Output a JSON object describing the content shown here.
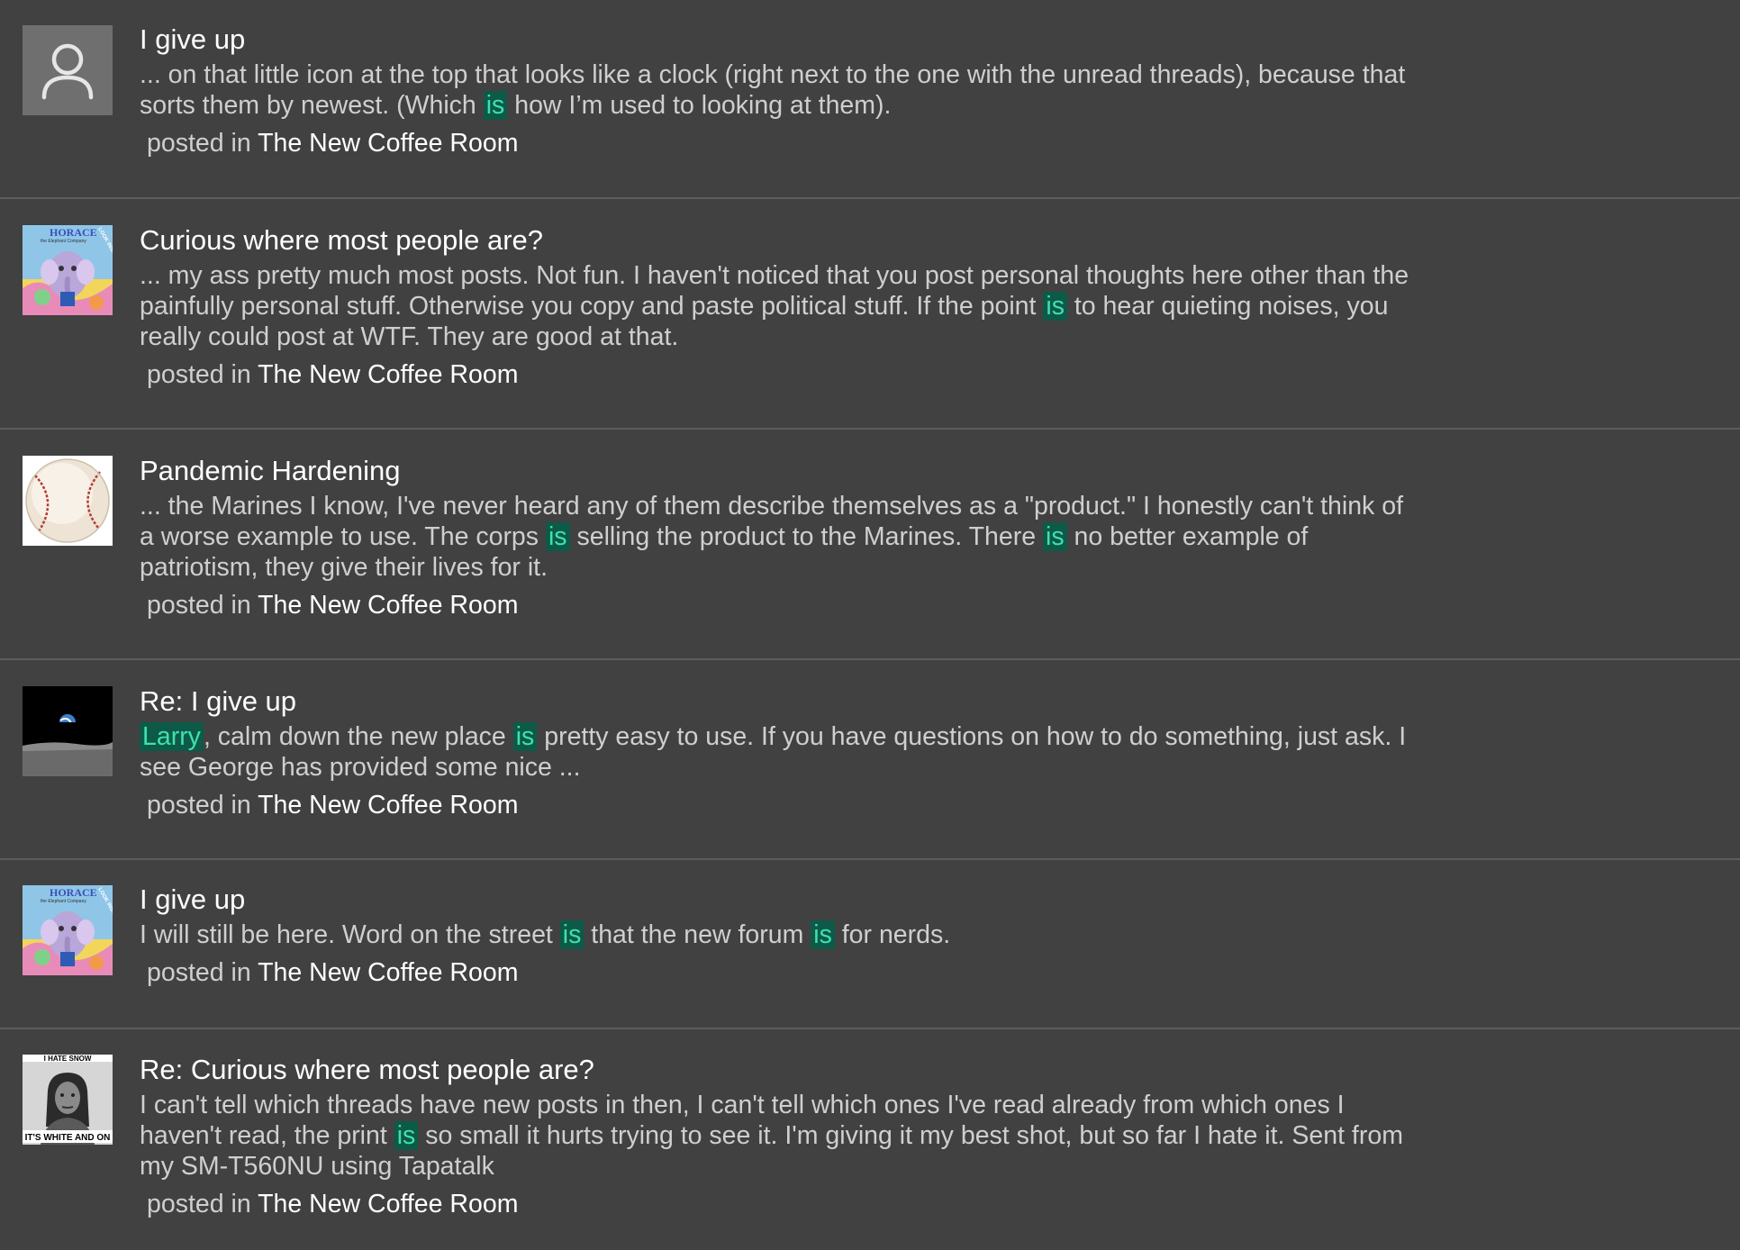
{
  "colors": {
    "background": "#414141",
    "divider": "#5c5c5c",
    "title_text": "#ffffff",
    "body_text": "#cfcfcf",
    "highlight_bg": "#0c5a47",
    "highlight_text": "#3fe0b0"
  },
  "results": [
    {
      "title": "I give up",
      "avatar": "default-user-icon",
      "snippet_parts": [
        {
          "text": "... on that little icon at the top that looks like a clock (right next to the one with the unread threads), because that sorts them by newest. (Which "
        },
        {
          "text": "is",
          "hl": true
        },
        {
          "text": " how I’m used to looking at them)."
        }
      ],
      "posted_label": "posted in",
      "category": "The New Coffee Room"
    },
    {
      "title": "Curious where most people are?",
      "avatar": "horace-elephant-avatar",
      "avatar_text": [
        "HORACE",
        "the Elephant Company",
        "LOOK INSIDE"
      ],
      "snippet_parts": [
        {
          "text": "... my ass pretty much most posts.   Not fun. I haven't noticed that you post personal thoughts here other than the painfully personal stuff. Otherwise you copy and paste political stuff. If the point "
        },
        {
          "text": "is",
          "hl": true
        },
        {
          "text": " to hear quieting noises, you really could post at WTF. They are good at that."
        }
      ],
      "posted_label": "posted in",
      "category": "The New Coffee Room"
    },
    {
      "title": "Pandemic Hardening",
      "avatar": "baseball-avatar",
      "snippet_parts": [
        {
          "text": "... the Marines I know, I've never heard any of them describe themselves as a \"product.\" I honestly can't think of a worse example to use. The corps "
        },
        {
          "text": "is",
          "hl": true
        },
        {
          "text": " selling the product to the Marines. There "
        },
        {
          "text": "is",
          "hl": true
        },
        {
          "text": " no better example of patriotism, they give their lives for it."
        }
      ],
      "posted_label": "posted in",
      "category": "The New Coffee Room"
    },
    {
      "title": "Re: I give up",
      "avatar": "earthrise-avatar",
      "snippet_parts": [
        {
          "text": "Larry",
          "hl": true
        },
        {
          "text": ", calm down the new place "
        },
        {
          "text": "is",
          "hl": true
        },
        {
          "text": " pretty easy to use. If you have questions on how to do something, just ask. I see George has provided some nice ..."
        }
      ],
      "posted_label": "posted in",
      "category": "The New Coffee Room"
    },
    {
      "title": "I give up",
      "avatar": "horace-elephant-avatar",
      "avatar_text": [
        "HORACE",
        "the Elephant Company",
        "LOOK INSIDE"
      ],
      "snippet_parts": [
        {
          "text": "I will still be here. Word on the street "
        },
        {
          "text": "is",
          "hl": true
        },
        {
          "text": " that the new forum "
        },
        {
          "text": "is",
          "hl": true
        },
        {
          "text": " for nerds."
        }
      ],
      "posted_label": "posted in",
      "category": "The New Coffee Room"
    },
    {
      "title": "Re: Curious where most people are?",
      "avatar": "meme-portrait-avatar",
      "avatar_text": [
        "I HATE SNOW",
        "IT'S WHITE AND ON"
      ],
      "snippet_parts": [
        {
          "text": "I can't tell which threads have new posts in then, I can't tell which ones I've read already from which ones I haven't read, the print "
        },
        {
          "text": "is",
          "hl": true
        },
        {
          "text": " so small it hurts trying to see it. I'm giving it my best shot, but so far I hate it. Sent from my SM-T560NU using Tapatalk"
        }
      ],
      "posted_label": "posted in",
      "category": "The New Coffee Room"
    }
  ]
}
